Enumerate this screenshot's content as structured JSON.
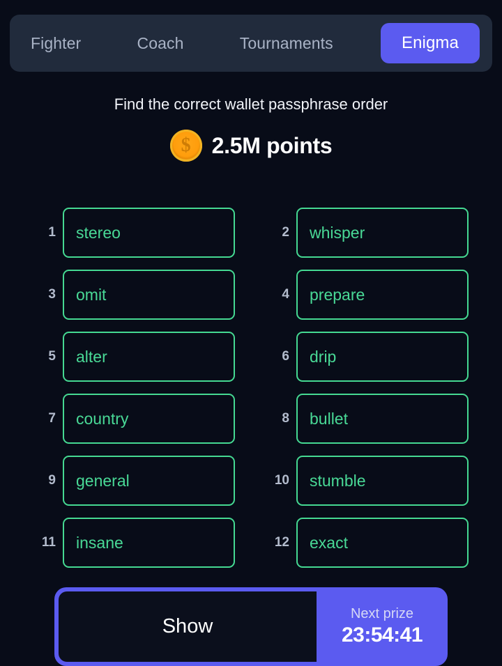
{
  "colors": {
    "page_background": "#080c18",
    "tabbar_background": "#212b3c",
    "accent_purple": "#5b5bf0",
    "word_green": "#45d992",
    "text_muted": "#a9b3c6"
  },
  "tabs": [
    {
      "label": "Fighter",
      "active": false
    },
    {
      "label": "Coach",
      "active": false
    },
    {
      "label": "Tournaments",
      "active": false
    },
    {
      "label": "Enigma",
      "active": true
    }
  ],
  "header": {
    "subtitle": "Find the correct wallet passphrase order",
    "coin_icon": "coin-dollar-icon",
    "coin_symbol": "$",
    "points": "2.5M points"
  },
  "words": [
    {
      "index": "1",
      "word": "stereo"
    },
    {
      "index": "2",
      "word": "whisper"
    },
    {
      "index": "3",
      "word": "omit"
    },
    {
      "index": "4",
      "word": "prepare"
    },
    {
      "index": "5",
      "word": "alter"
    },
    {
      "index": "6",
      "word": "drip"
    },
    {
      "index": "7",
      "word": "country"
    },
    {
      "index": "8",
      "word": "bullet"
    },
    {
      "index": "9",
      "word": "general"
    },
    {
      "index": "10",
      "word": "stumble"
    },
    {
      "index": "11",
      "word": "insane"
    },
    {
      "index": "12",
      "word": "exact"
    }
  ],
  "footer": {
    "show_label": "Show",
    "prize_label": "Next prize",
    "prize_time": "23:54:41"
  }
}
